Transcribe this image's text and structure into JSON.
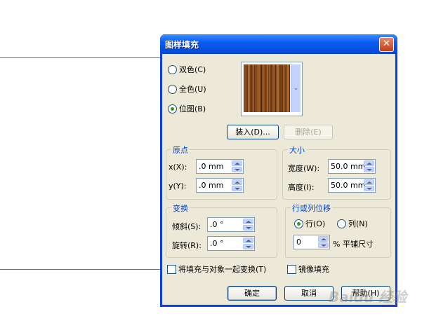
{
  "dialog": {
    "title": "图样填充",
    "close_glyph": "✕"
  },
  "fill_type": {
    "options": [
      {
        "label": "双色(C)",
        "checked": false
      },
      {
        "label": "全色(U)",
        "checked": false
      },
      {
        "label": "位图(B)",
        "checked": true
      }
    ]
  },
  "preview": {
    "dropdown_glyph": "⌄"
  },
  "buttons": {
    "load": "装入(D)...",
    "delete": "删除(E)",
    "ok": "确定",
    "cancel": "取消",
    "help": "帮助(H)"
  },
  "origin": {
    "title": "原点",
    "x_label": "x(X):",
    "x_value": ".0 mm",
    "y_label": "y(Y):",
    "y_value": ".0 mm"
  },
  "size": {
    "title": "大小",
    "width_label": "宽度(W):",
    "width_value": "50.0 mm",
    "height_label": "高度(I):",
    "height_value": "50.0 mm"
  },
  "transform": {
    "title": "变换",
    "skew_label": "倾斜(S):",
    "skew_value": ".0 °",
    "rotate_label": "旋转(R):",
    "rotate_value": ".0 °"
  },
  "offset": {
    "title": "行或列位移",
    "row_label": "行(O)",
    "row_checked": true,
    "col_label": "列(N)",
    "col_checked": false,
    "amount_value": "0",
    "amount_suffix": "% 平铺尺寸"
  },
  "options": {
    "transform_with_object": "将填充与对象一起变换(T)",
    "mirror_fill": "镜像填充"
  },
  "watermark": "Baidu 经验"
}
